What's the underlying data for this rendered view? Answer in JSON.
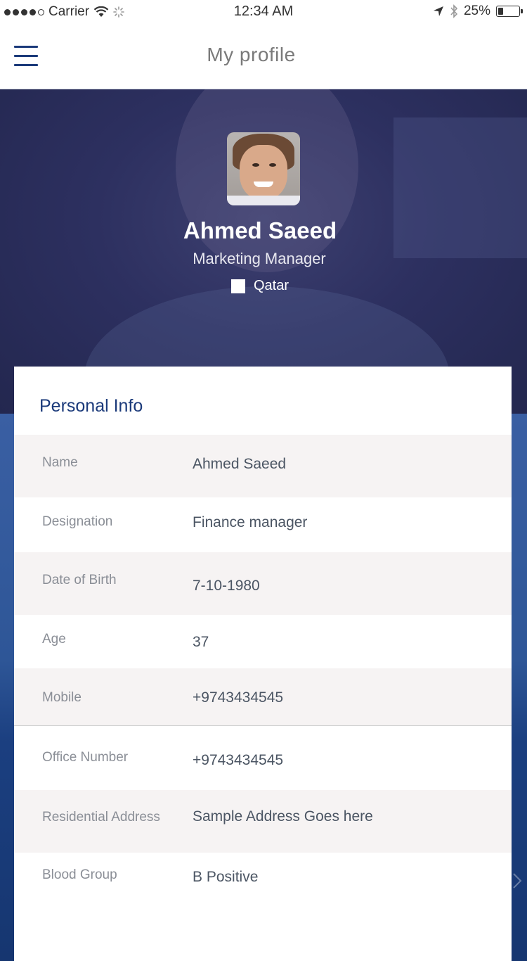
{
  "status_bar": {
    "carrier": "Carrier",
    "time": "12:34 AM",
    "battery": "25%",
    "battery_fraction": 0.25
  },
  "nav": {
    "title": "My profile",
    "menu_icon": "hamburger-menu-icon"
  },
  "profile": {
    "name": "Ahmed Saeed",
    "role": "Marketing Manager",
    "country": "Qatar"
  },
  "personal_info": {
    "title": "Personal Info",
    "rows": [
      {
        "label": "Name",
        "value": "Ahmed Saeed"
      },
      {
        "label": "Designation",
        "value": "Finance manager"
      },
      {
        "label": "Date of Birth",
        "value": "7-10-1980"
      },
      {
        "label": "Age",
        "value": "37"
      },
      {
        "label": "Mobile",
        "value": "+9743434545"
      },
      {
        "label": "Office Number",
        "value": "+9743434545"
      },
      {
        "label": "Residential Address",
        "value": "Sample Address Goes here"
      },
      {
        "label": "Blood Group",
        "value": "B Positive"
      }
    ]
  },
  "colors": {
    "accent": "#1b3a7a",
    "row_shade": "#f6f3f3",
    "label": "#8a8e96",
    "value": "#4b5563"
  }
}
